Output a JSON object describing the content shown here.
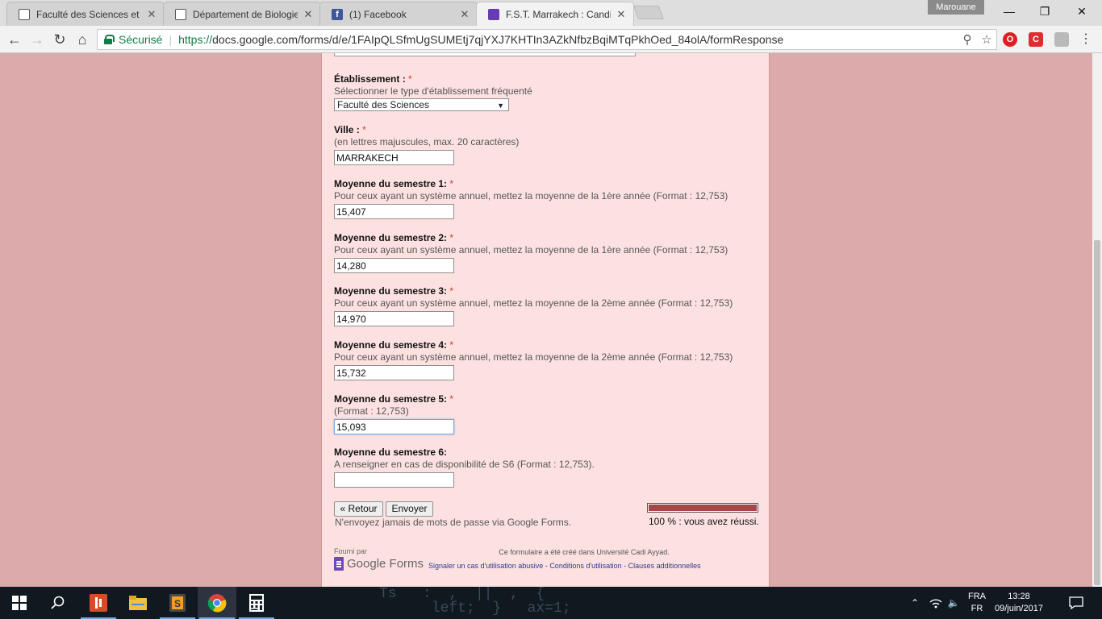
{
  "browser": {
    "tabs": [
      {
        "title": "Faculté des Sciences et Te",
        "icon": "document-icon"
      },
      {
        "title": "Département de Biologie",
        "icon": "document-icon"
      },
      {
        "title": "(1) Facebook",
        "icon": "facebook-icon"
      },
      {
        "title": "F.S.T. Marrakech : Candid",
        "icon": "google-forms-icon"
      }
    ],
    "close_glyph": "✕",
    "profile_name": "Marouane",
    "secure_label": "Sécurisé",
    "url_protocol": "https://",
    "url_rest": "docs.google.com/forms/d/e/1FAIpQLSfmUgSUMEtj7qjYXJ7KHTIn3AZkNfbzBqiMTqPkhOed_84olA/formResponse"
  },
  "form": {
    "questions": [
      {
        "title": "Établissement :",
        "required": "*",
        "help": "Sélectionner le type d'établissement fréquenté",
        "type": "select",
        "value": "Faculté des Sciences"
      },
      {
        "title": "Ville :",
        "required": "*",
        "help": "(en lettres majuscules, max. 20 caractères)",
        "type": "text",
        "value": "MARRAKECH"
      },
      {
        "title": "Moyenne du semestre 1:",
        "required": "*",
        "help": "Pour ceux ayant un système annuel, mettez la moyenne de la 1ère année (Format : 12,753)",
        "type": "text",
        "value": "15,407"
      },
      {
        "title": "Moyenne du semestre 2:",
        "required": "*",
        "help": "Pour ceux ayant un système annuel, mettez la moyenne de la 1ère année (Format : 12,753)",
        "type": "text",
        "value": "14,280"
      },
      {
        "title": "Moyenne du semestre 3:",
        "required": "*",
        "help": "Pour ceux ayant un système annuel, mettez la moyenne de la 2ème année (Format : 12,753)",
        "type": "text",
        "value": "14,970"
      },
      {
        "title": "Moyenne du semestre 4:",
        "required": "*",
        "help": "Pour ceux ayant un système annuel, mettez la moyenne de la 2ème année (Format : 12,753)",
        "type": "text",
        "value": "15,732"
      },
      {
        "title": "Moyenne du semestre 5:",
        "required": "*",
        "help": "(Format : 12,753)",
        "type": "text",
        "value": "15,093"
      },
      {
        "title": "Moyenne du semestre 6:",
        "required": "",
        "help": "A renseigner en cas de disponibilité de S6 (Format : 12,753).",
        "type": "text",
        "value": ""
      }
    ],
    "back_label": "« Retour",
    "submit_label": "Envoyer",
    "password_note": "N'envoyez jamais de mots de passe via Google Forms.",
    "progress_percent": 100,
    "progress_text": "100 % : vous avez réussi.",
    "accent_color": "#a94448"
  },
  "footer": {
    "powered_by": "Fourni par",
    "logo_text": "Google Forms",
    "created_in": "Ce formulaire a été créé dans Université Cadi Ayyad.",
    "link_abuse": "Signaler un cas d'utilisation abusive",
    "link_terms": "Conditions d'utilisation",
    "link_additional": "Clauses additionnelles",
    "link_separator": " - "
  },
  "taskbar": {
    "wallpaper_line1": "Ts   :  ,  ||  ,  {",
    "wallpaper_line2": "      left;  }   ax=1;",
    "lang_top": "FRA",
    "lang_bottom": "FR",
    "time": "13:28",
    "date": "09/juin/2017"
  }
}
